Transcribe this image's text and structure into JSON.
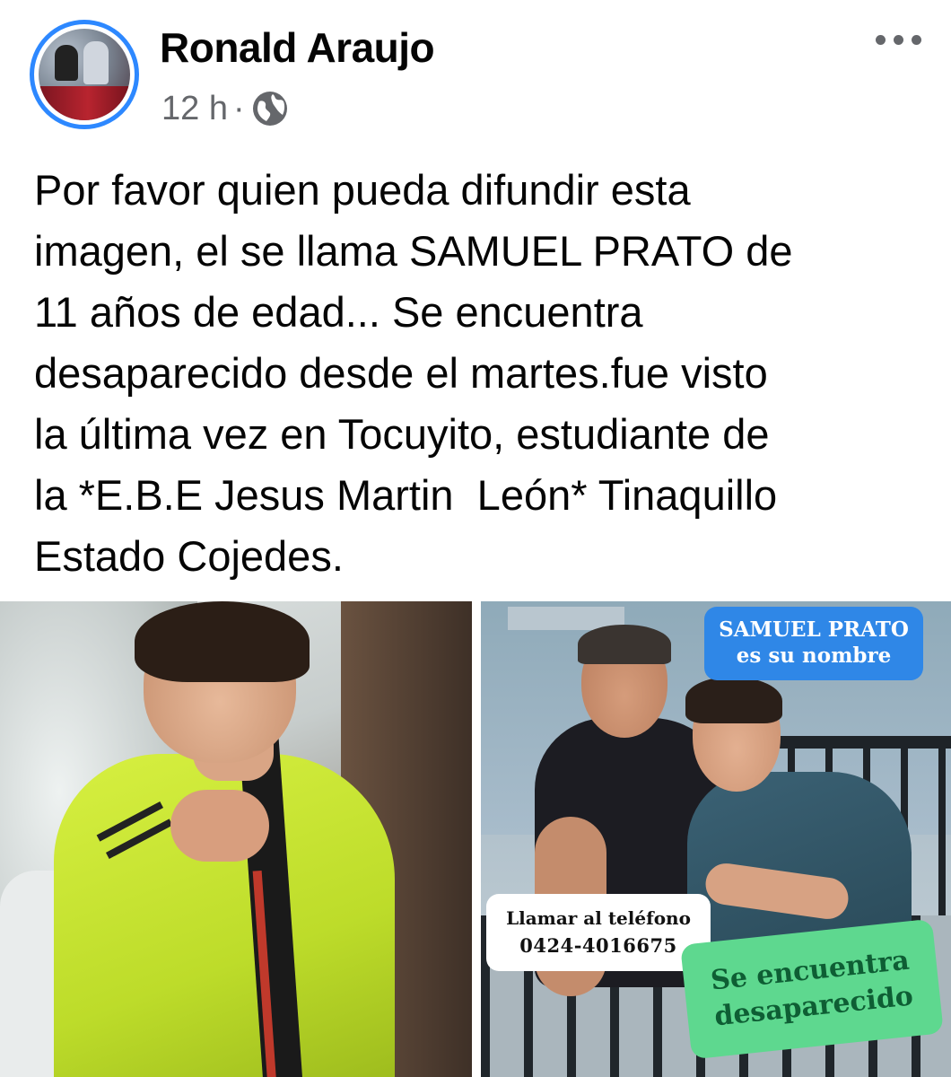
{
  "post": {
    "author": "Ronald Araujo",
    "time": "12 h",
    "separator": "·",
    "audience_icon": "globe-icon",
    "more_icon": "more-options-icon",
    "text": "Por favor quien pueda difundir esta\nimagen, el se llama SAMUEL PRATO de\n11 años de edad... Se encuentra\ndesaparecido desde el martes.fue visto\nla última vez en Tocuyito, estudiante de\nla *E.B.E Jesus Martin  León* Tinaquillo\nEstado Cojedes."
  },
  "photos": {
    "right": {
      "name_badge": {
        "line1": "SAMUEL PRATO",
        "line2": "es su nombre"
      },
      "phone_badge": {
        "line1": "Llamar al teléfono",
        "line2": "0424-4016675"
      },
      "missing_badge": {
        "line1": "Se encuentra",
        "line2": "desaparecido"
      }
    }
  },
  "colors": {
    "avatar_ring": "#2d88ff",
    "name_badge": "#2f87e7",
    "missing_badge": "#5ed88f",
    "meta_text": "#65676b"
  }
}
